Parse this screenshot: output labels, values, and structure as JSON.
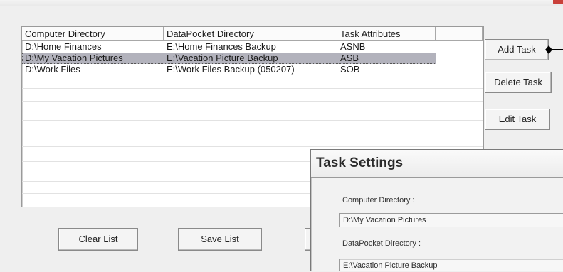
{
  "list": {
    "columns": [
      "Computer Directory",
      "DataPocket Directory",
      "Task Attributes",
      ""
    ],
    "rows": [
      {
        "computer": "D:\\Home Finances",
        "datapocket": "E:\\Home Finances Backup",
        "attributes": "ASNB",
        "selected": false
      },
      {
        "computer": "D:\\My Vacation Pictures",
        "datapocket": "E:\\Vacation Picture Backup",
        "attributes": "ASB",
        "selected": true
      },
      {
        "computer": "D:\\Work Files",
        "datapocket": "E:\\Work Files Backup (050207)",
        "attributes": "SOB",
        "selected": false
      }
    ]
  },
  "buttons": {
    "add": "Add Task",
    "delete": "Delete Task",
    "edit": "Edit Task",
    "clear": "Clear List",
    "save": "Save List"
  },
  "settings": {
    "title": "Task Settings",
    "computer_label": "Computer Directory :",
    "computer_value": "D:\\My Vacation Pictures",
    "datapocket_label": "DataPocket Directory :",
    "datapocket_value": "E:\\Vacation Picture Backup"
  },
  "colors": {
    "selection": "#b2b2bc",
    "close_button": "#c9403a"
  }
}
